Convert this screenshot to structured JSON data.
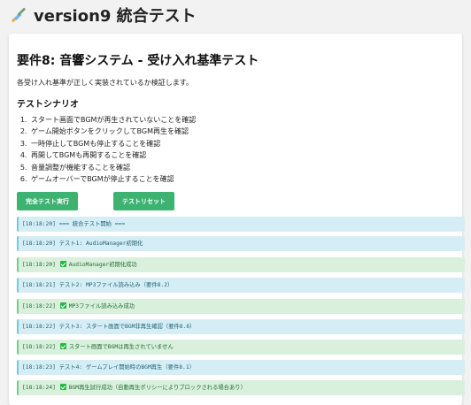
{
  "app": {
    "title": "version9 統合テスト",
    "icon": "paintbrush-icon"
  },
  "main": {
    "title": "要件8: 音響システム - 受け入れ基準テスト",
    "intro": "各受け入れ基準が正しく実装されているか検証します。",
    "scenario_title": "テストシナリオ",
    "steps": [
      "スタート画面でBGMが再生されていないことを確認",
      "ゲーム開始ボタンをクリックしてBGM再生を確認",
      "一時停止してBGMも停止することを確認",
      "再開してBGMも再開することを確認",
      "音量調整が機能することを確認",
      "ゲームオーバーでBGMが停止することを確認"
    ],
    "buttons": {
      "run": "完全テスト実行",
      "reset": "テストリセット"
    }
  },
  "colors": {
    "accent": "#3cb371",
    "info_bg": "#d5eef6",
    "success_bg": "#d8f0dc"
  },
  "logs": [
    {
      "type": "info",
      "time": "[18:18:20]",
      "text": "=== 統合テスト開始 ===",
      "check": false
    },
    {
      "type": "info",
      "time": "[18:18:20]",
      "text": "テスト1: AudioManager初期化",
      "check": false
    },
    {
      "type": "success",
      "time": "[18:18:20]",
      "text": "AudioManager初期化成功",
      "check": true
    },
    {
      "type": "info",
      "time": "[18:18:21]",
      "text": "テスト2: MP3ファイル読み込み（要件8.2）",
      "check": false
    },
    {
      "type": "success",
      "time": "[18:18:22]",
      "text": "MP3ファイル読み込み成功",
      "check": true
    },
    {
      "type": "info",
      "time": "[18:18:22]",
      "text": "テスト3: スタート画面でBGM非再生確認（要件8.6）",
      "check": false
    },
    {
      "type": "success",
      "time": "[18:18:22]",
      "text": "スタート画面でBGMは再生されていません",
      "check": true
    },
    {
      "type": "info",
      "time": "[18:18:23]",
      "text": "テスト4: ゲームプレイ開始時のBGM再生（要件8.1）",
      "check": false
    },
    {
      "type": "success",
      "time": "[18:18:24]",
      "text": "BGM再生試行成功（自動再生ポリシーによりブロックされる場合あり）",
      "check": true
    }
  ]
}
